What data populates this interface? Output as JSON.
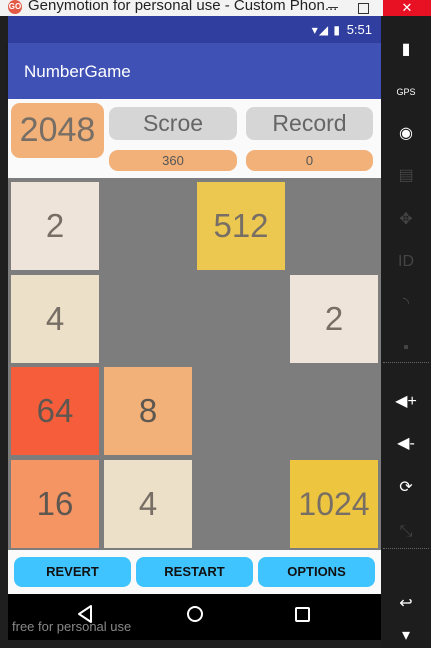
{
  "window": {
    "title": "Genymotion for personal use - Custom Phon...",
    "close_glyph": "✕"
  },
  "status_bar": {
    "icons": "▾◢ ▮",
    "time": "5:51"
  },
  "app_bar": {
    "title": "NumberGame"
  },
  "header": {
    "logo": "2048",
    "score_label": "Scroe",
    "score_value": "360",
    "record_label": "Record",
    "record_value": "0"
  },
  "board": {
    "tiles": [
      {
        "value": "2",
        "row": 0,
        "col": 0
      },
      {
        "value": "512",
        "row": 0,
        "col": 2
      },
      {
        "value": "4",
        "row": 1,
        "col": 0
      },
      {
        "value": "2",
        "row": 1,
        "col": 3
      },
      {
        "value": "64",
        "row": 2,
        "col": 0
      },
      {
        "value": "8",
        "row": 2,
        "col": 1
      },
      {
        "value": "16",
        "row": 3,
        "col": 0
      },
      {
        "value": "4",
        "row": 3,
        "col": 1
      },
      {
        "value": "1024",
        "row": 3,
        "col": 3
      }
    ],
    "colors": {
      "board": "#7d7d7d",
      "tile_2": "#eee4da",
      "tile_4": "#ede0c8",
      "tile_8": "#f2b179",
      "tile_16": "#f59563",
      "tile_64": "#f65e3b",
      "tile_512": "#edc850",
      "tile_1024": "#edc53f"
    }
  },
  "buttons": {
    "revert": "REVERT",
    "restart": "RESTART",
    "options": "OPTIONS"
  },
  "nav_bar": {
    "back_icon": "back-icon",
    "home_icon": "home-icon",
    "recent_icon": "recent-apps-icon"
  },
  "watermark": "free for personal use",
  "side_toolbar": {
    "items": [
      {
        "name": "battery-icon",
        "glyph": "▮"
      },
      {
        "name": "gps-icon",
        "glyph": "GPS"
      },
      {
        "name": "camera-icon",
        "glyph": "◉"
      },
      {
        "name": "video-capture-icon",
        "glyph": "▤"
      },
      {
        "name": "dpad-icon",
        "glyph": "✥"
      },
      {
        "name": "id-icon",
        "glyph": "ID"
      },
      {
        "name": "network-icon",
        "glyph": "◝"
      },
      {
        "name": "sms-icon",
        "glyph": "▪"
      },
      {
        "name": "volume-up-icon",
        "glyph": "◀+"
      },
      {
        "name": "volume-down-icon",
        "glyph": "◀-"
      },
      {
        "name": "rotate-icon",
        "glyph": "⟳"
      },
      {
        "name": "pixel-perfect-icon",
        "glyph": "⤡"
      },
      {
        "name": "back-icon",
        "glyph": "↩"
      },
      {
        "name": "menu-icon",
        "glyph": "▾"
      }
    ]
  }
}
